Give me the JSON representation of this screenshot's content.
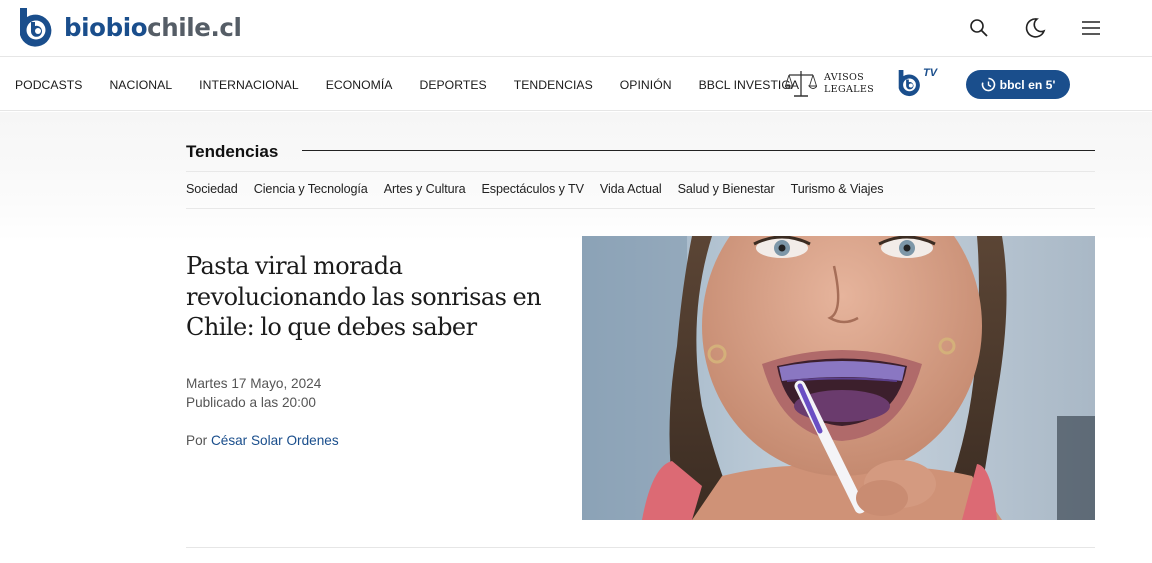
{
  "brand": {
    "name_part1": "biobio",
    "name_part2": "chile.cl",
    "primary_color": "#1a4e8c",
    "secondary_color": "#555d66"
  },
  "header_icons": [
    "search-icon",
    "moon-icon",
    "menu-icon"
  ],
  "nav": {
    "items": [
      "PODCASTS",
      "NACIONAL",
      "INTERNACIONAL",
      "ECONOMÍA",
      "DEPORTES",
      "TENDENCIAS",
      "OPINIÓN",
      "BBCL INVESTIGA"
    ],
    "avisos_line1": "AVISOS",
    "avisos_line2": "LEGALES",
    "tv_label": "TV",
    "bbcl5_label": "bbcl en 5'"
  },
  "section": {
    "title": "Tendencias",
    "subnav": [
      "Sociedad",
      "Ciencia y Tecnología",
      "Artes y Cultura",
      "Espectáculos y TV",
      "Vida Actual",
      "Salud y Bienestar",
      "Turismo & Viajes"
    ]
  },
  "article": {
    "headline": "Pasta viral morada revolucionando las sonrisas en Chile: lo que debes saber",
    "date": "Martes 17 Mayo, 2024",
    "published": "Publicado a las 20:00",
    "byline_prefix": "Por",
    "author": "César Solar Ordenes"
  }
}
